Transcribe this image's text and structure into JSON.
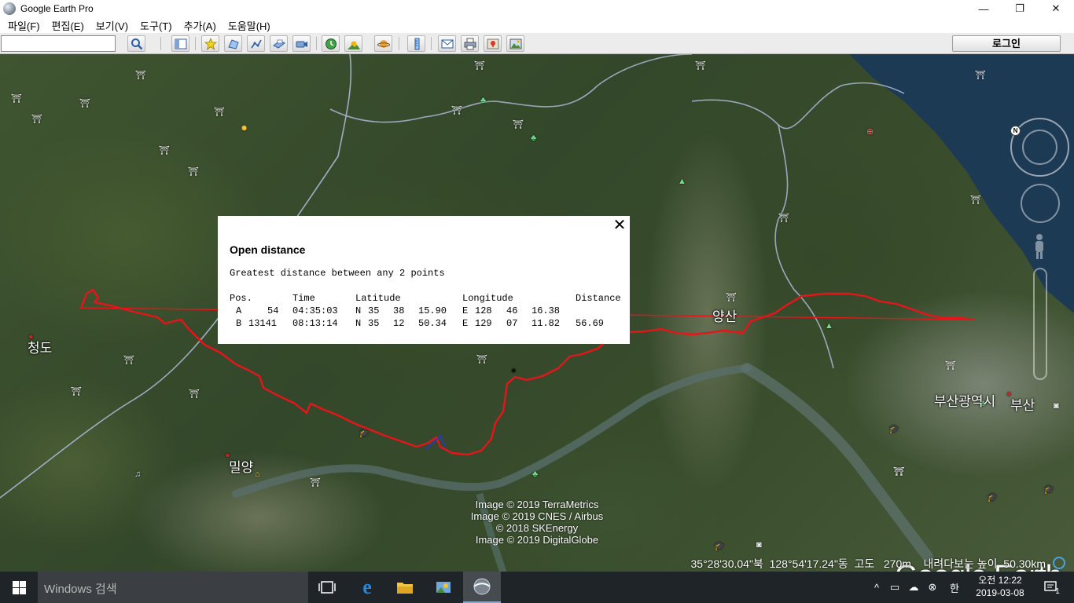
{
  "window": {
    "title": "Google Earth Pro",
    "controls": {
      "minimize": "—",
      "maximize": "❐",
      "close": "✕"
    }
  },
  "menubar": {
    "items": [
      {
        "label": "파일(F)"
      },
      {
        "label": "편집(E)"
      },
      {
        "label": "보기(V)"
      },
      {
        "label": "도구(T)"
      },
      {
        "label": "추가(A)"
      },
      {
        "label": "도움말(H)"
      }
    ]
  },
  "toolbar": {
    "search_value": "",
    "login_label": "로그인"
  },
  "balloon": {
    "title": "Open distance",
    "description": "Greatest distance between any 2 points",
    "headers": [
      "Pos.",
      "Time",
      "Latitude",
      "Longitude",
      "Distance"
    ],
    "rows": [
      {
        "label": "A",
        "index": "54",
        "time": "04:35:03",
        "lat_dir": "N",
        "lat_deg": "35",
        "lat_min": "38",
        "lat_sec": "15.90",
        "lon_dir": "E",
        "lon_deg": "128",
        "lon_min": "46",
        "lon_sec": "16.38",
        "distance": ""
      },
      {
        "label": "B",
        "index": "13141",
        "time": "08:13:14",
        "lat_dir": "N",
        "lat_deg": "35",
        "lat_min": "12",
        "lat_sec": "50.34",
        "lon_dir": "E",
        "lon_deg": "129",
        "lon_min": "07",
        "lon_sec": "11.82",
        "distance": "56.69"
      }
    ],
    "close_label": "✕"
  },
  "map": {
    "places": [
      {
        "name": "청도"
      },
      {
        "name": "밀양"
      },
      {
        "name": "양산"
      },
      {
        "name": "부산광역시"
      },
      {
        "name": "부산"
      }
    ],
    "attribution": [
      "Image © 2019 TerraMetrics",
      "Image © 2019 CNES / Airbus",
      "© 2018 SKEnergy",
      "Image © 2019 DigitalGlobe"
    ],
    "logo": "Google Earth",
    "track_color": "#e8141a",
    "border_color": "#aab9d4"
  },
  "statusbar": {
    "text": "35°28'30.04\"북  128°54'17.24\"동  고도   270m    내려다보는 높이  50.30km"
  },
  "taskbar": {
    "search_placeholder": "Windows 검색",
    "ime": "한",
    "time": "오전 12:22",
    "date": "2019-03-08",
    "notification_count": "1"
  }
}
